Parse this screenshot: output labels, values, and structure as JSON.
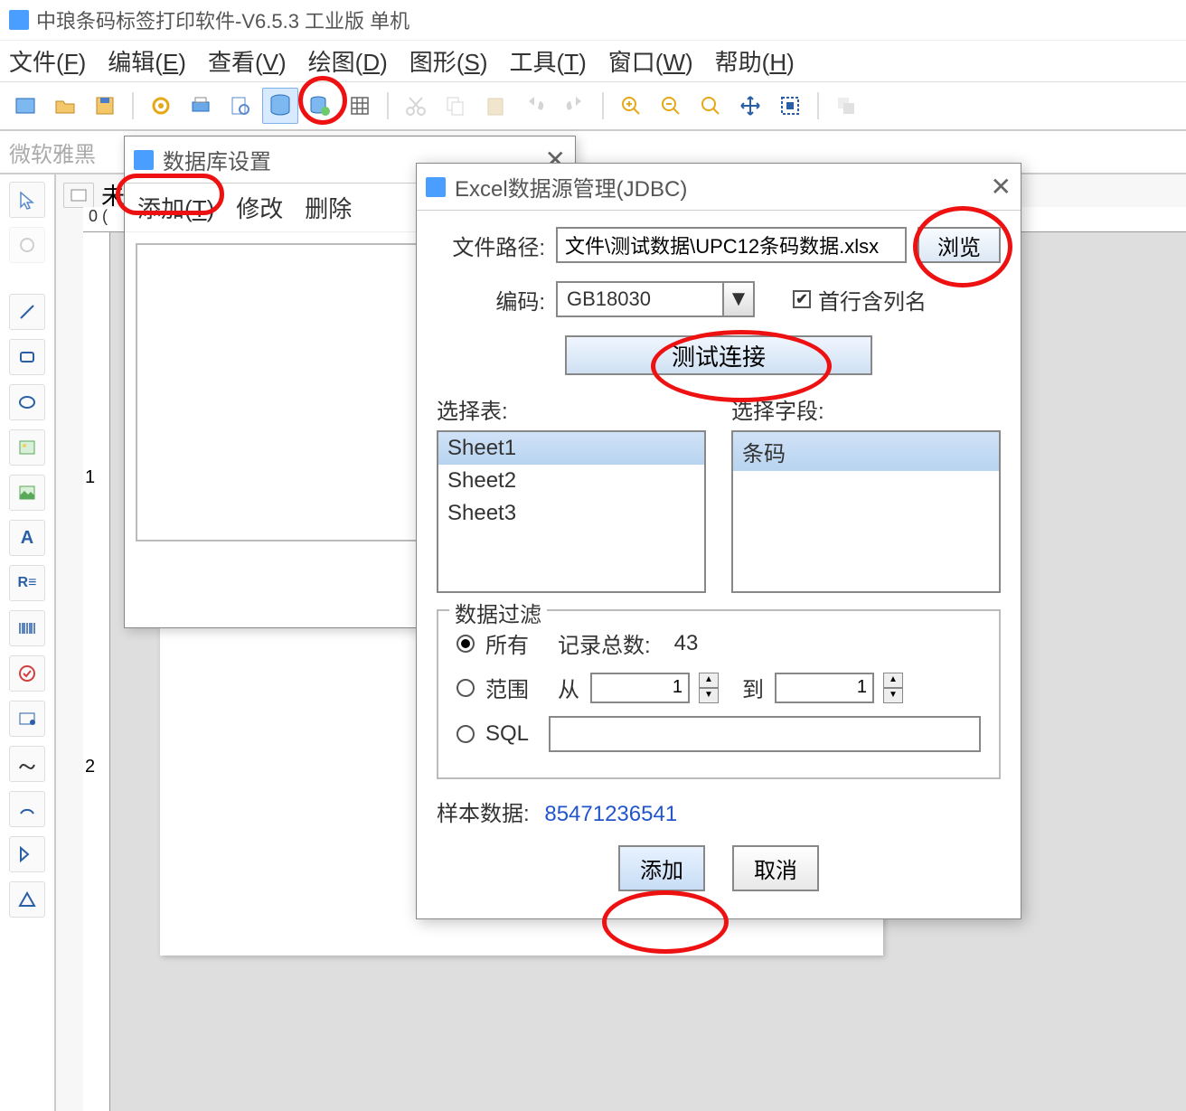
{
  "app": {
    "title": "中琅条码标签打印软件-V6.5.3 工业版 单机"
  },
  "menus": [
    {
      "label": "文件",
      "mn": "F"
    },
    {
      "label": "编辑",
      "mn": "E"
    },
    {
      "label": "查看",
      "mn": "V"
    },
    {
      "label": "绘图",
      "mn": "D"
    },
    {
      "label": "图形",
      "mn": "S"
    },
    {
      "label": "工具",
      "mn": "T"
    },
    {
      "label": "窗口",
      "mn": "W"
    },
    {
      "label": "帮助",
      "mn": "H"
    }
  ],
  "font": {
    "name": "微软雅黑"
  },
  "ruler": {
    "zero": "0",
    "tick1": "1",
    "tick2": "2"
  },
  "canvas_tab": "未",
  "db_dialog": {
    "title": "数据库设置",
    "add": "添加",
    "add_mn": "T",
    "modify": "修改",
    "delete": "删除",
    "close": "关闭"
  },
  "excel_dialog": {
    "title": "Excel数据源管理(JDBC)",
    "file_path_label": "文件路径:",
    "file_path_value": "文件\\测试数据\\UPC12条码数据.xlsx",
    "browse": "浏览",
    "encoding_label": "编码:",
    "encoding_value": "GB18030",
    "first_row_header": "首行含列名",
    "test_connection": "测试连接",
    "select_table": "选择表:",
    "select_field": "选择字段:",
    "tables": [
      "Sheet1",
      "Sheet2",
      "Sheet3"
    ],
    "fields": [
      "条码"
    ],
    "filter": {
      "legend": "数据过滤",
      "all": "所有",
      "record_count_label": "记录总数:",
      "record_count": "43",
      "range": "范围",
      "from_label": "从",
      "from_value": "1",
      "to_label": "到",
      "to_value": "1",
      "sql": "SQL",
      "sql_value": ""
    },
    "sample_label": "样本数据:",
    "sample_value": "85471236541",
    "add_btn": "添加",
    "cancel_btn": "取消"
  }
}
